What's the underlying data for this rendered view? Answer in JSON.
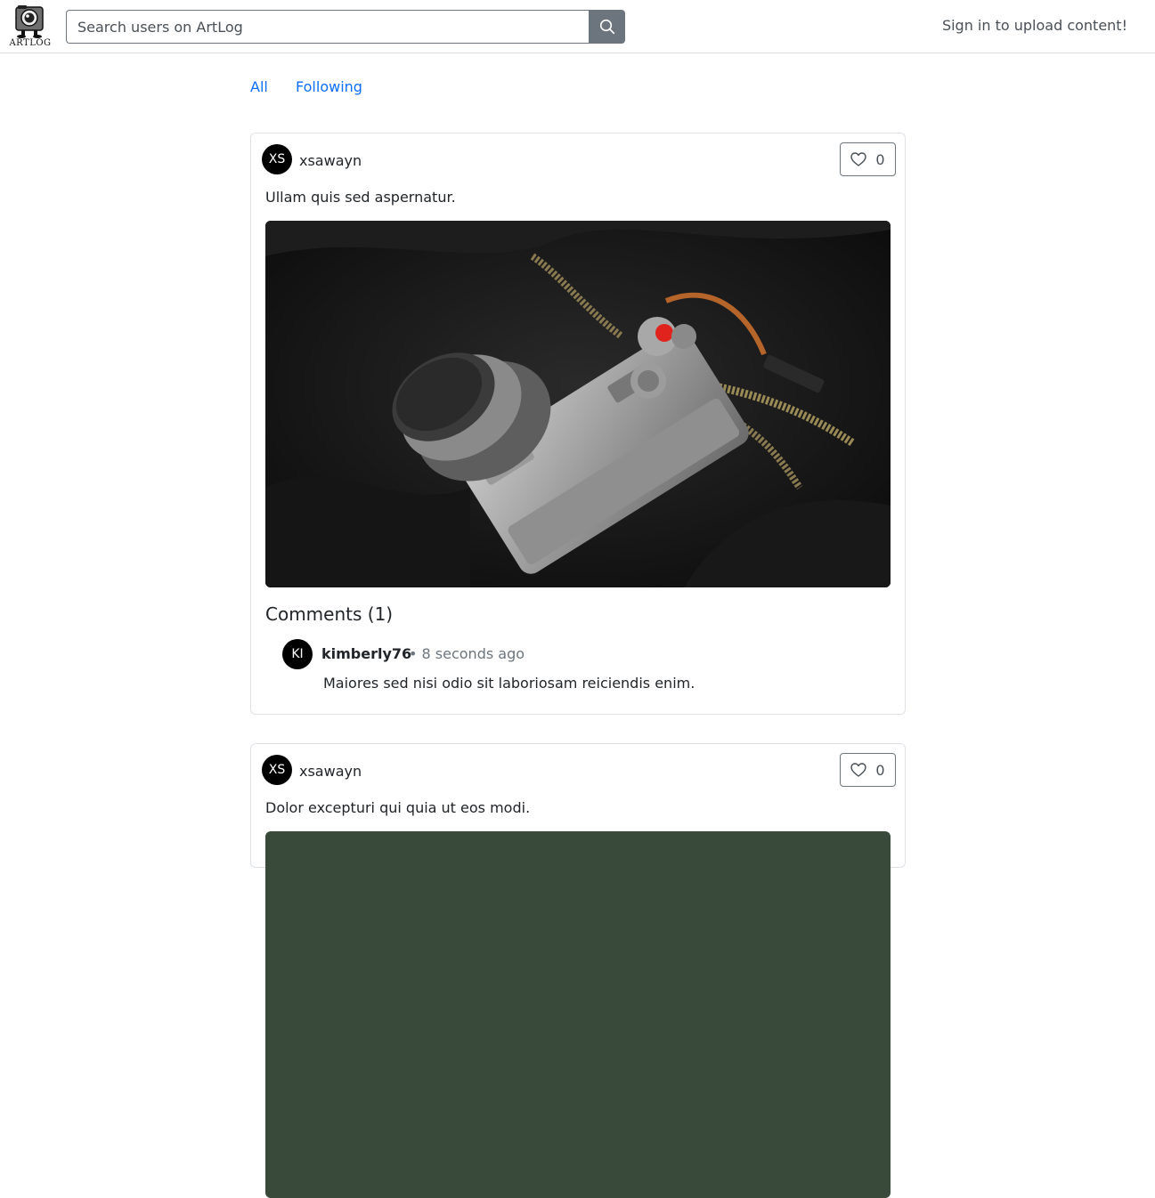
{
  "header": {
    "logo_text": "ARTLOG",
    "search": {
      "placeholder": "Search users on ArtLog",
      "value": ""
    },
    "signin_label": "Sign in to upload content!"
  },
  "feed_tabs": [
    {
      "label": "All"
    },
    {
      "label": "Following"
    }
  ],
  "posts": [
    {
      "avatar_initials": "XS",
      "username": "xsawayn",
      "likes": "0",
      "caption": "Ullam quis sed aspernatur.",
      "image_subject": "camera",
      "comments_title": "Comments (1)",
      "comments": [
        {
          "avatar_initials": "KI",
          "username": "kimberly76",
          "time": "• 8 seconds ago",
          "text": "Maiores sed nisi odio sit laboriosam reiciendis enim."
        }
      ]
    },
    {
      "avatar_initials": "XS",
      "username": "xsawayn",
      "likes": "0",
      "caption": "Dolor excepturi qui quia ut eos modi."
    }
  ],
  "colors": {
    "link": "#0d6efd",
    "search_button": "#6c757d",
    "avatar": "#000000",
    "border": "#dee2e6"
  },
  "icons": [
    "artlog-camera-logo-icon",
    "search-icon",
    "heart-outline-icon"
  ]
}
